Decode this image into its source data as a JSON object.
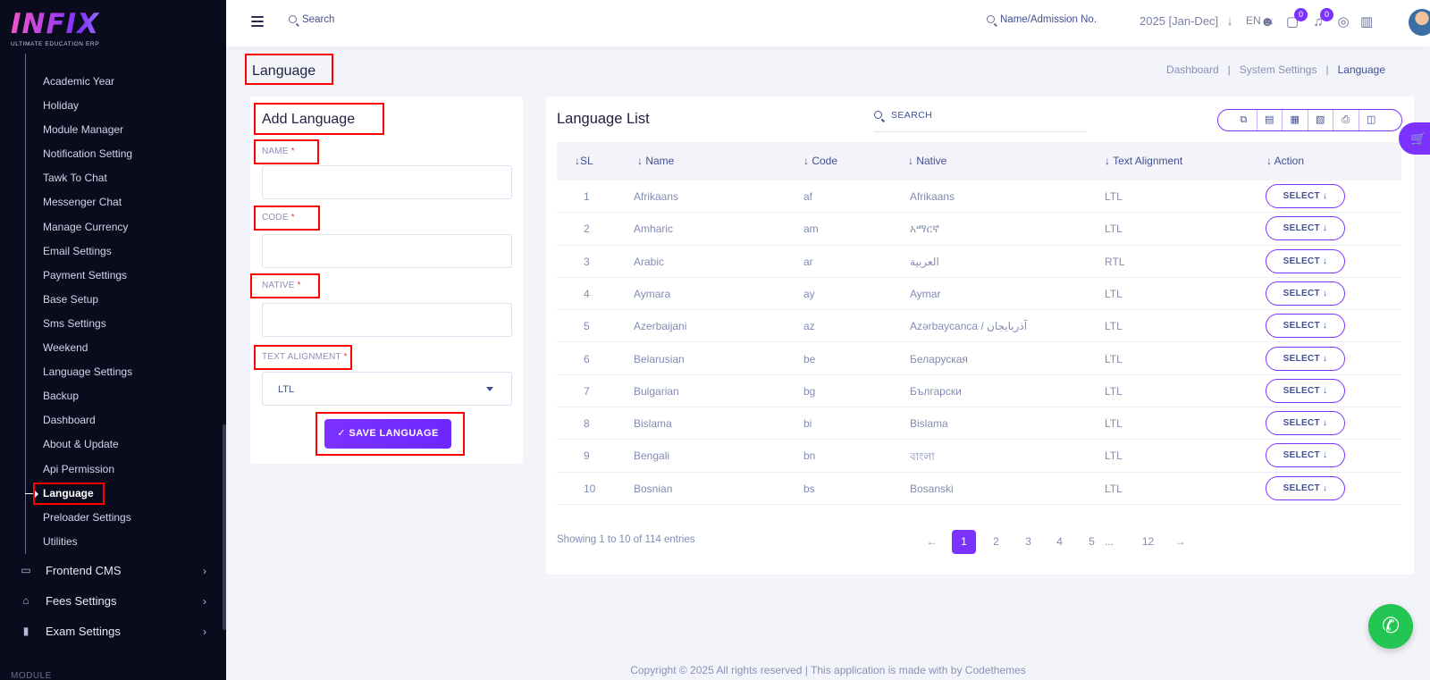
{
  "brand": {
    "logo_text": "INFIX",
    "tagline": "ULTIMATE EDUCATION ERP"
  },
  "sidebar": {
    "sub_items": [
      {
        "label": "Academic Year"
      },
      {
        "label": "Holiday"
      },
      {
        "label": "Module Manager"
      },
      {
        "label": "Notification Setting"
      },
      {
        "label": "Tawk To Chat"
      },
      {
        "label": "Messenger Chat"
      },
      {
        "label": "Manage Currency"
      },
      {
        "label": "Email Settings"
      },
      {
        "label": "Payment Settings"
      },
      {
        "label": "Base Setup"
      },
      {
        "label": "Sms Settings"
      },
      {
        "label": "Weekend"
      },
      {
        "label": "Language Settings"
      },
      {
        "label": "Backup"
      },
      {
        "label": "Dashboard"
      },
      {
        "label": "About & Update"
      },
      {
        "label": "Api Permission"
      },
      {
        "label": "Language",
        "active": true
      },
      {
        "label": "Preloader Settings"
      },
      {
        "label": "Utilities"
      }
    ],
    "main_items": [
      {
        "label": "Frontend CMS",
        "icon": "monitor-icon"
      },
      {
        "label": "Fees Settings",
        "icon": "bank-icon"
      },
      {
        "label": "Exam Settings",
        "icon": "book-icon"
      }
    ],
    "section_label": "MODULE"
  },
  "topbar": {
    "search_label": "Search",
    "name_search_label": "Name/Admission No.",
    "session": "2025 [Jan-Dec]",
    "language": "EN",
    "messages_count": "0",
    "notifications_count": "0"
  },
  "page": {
    "title": "Language",
    "breadcrumb": [
      "Dashboard",
      "System Settings",
      "Language"
    ]
  },
  "form": {
    "title": "Add Language",
    "name_label": "NAME",
    "code_label": "CODE",
    "native_label": "NATIVE",
    "alignment_label": "TEXT ALIGNMENT",
    "required_mark": "*",
    "alignment_value": "LTL",
    "save_label": "SAVE LANGUAGE"
  },
  "list": {
    "title": "Language List",
    "search_placeholder": "SEARCH",
    "columns": [
      "SL",
      "Name",
      "Code",
      "Native",
      "Text Alignment",
      "Action"
    ],
    "rows": [
      {
        "sl": "1",
        "name": "Afrikaans",
        "code": "af",
        "native": "Afrikaans",
        "align": "LTL",
        "action": "SELECT"
      },
      {
        "sl": "2",
        "name": "Amharic",
        "code": "am",
        "native": "አማርኛ",
        "align": "LTL",
        "action": "SELECT"
      },
      {
        "sl": "3",
        "name": "Arabic",
        "code": "ar",
        "native": "العربية",
        "align": "RTL",
        "action": "SELECT"
      },
      {
        "sl": "4",
        "name": "Aymara",
        "code": "ay",
        "native": "Aymar",
        "align": "LTL",
        "action": "SELECT"
      },
      {
        "sl": "5",
        "name": "Azerbaijani",
        "code": "az",
        "native": "Azərbaycanca / آذربایجان",
        "align": "LTL",
        "action": "SELECT"
      },
      {
        "sl": "6",
        "name": "Belarusian",
        "code": "be",
        "native": "Беларуская",
        "align": "LTL",
        "action": "SELECT"
      },
      {
        "sl": "7",
        "name": "Bulgarian",
        "code": "bg",
        "native": "Български",
        "align": "LTL",
        "action": "SELECT"
      },
      {
        "sl": "8",
        "name": "Bislama",
        "code": "bi",
        "native": "Bislama",
        "align": "LTL",
        "action": "SELECT"
      },
      {
        "sl": "9",
        "name": "Bengali",
        "code": "bn",
        "native": "বাংলা",
        "align": "LTL",
        "action": "SELECT"
      },
      {
        "sl": "10",
        "name": "Bosnian",
        "code": "bs",
        "native": "Bosanski",
        "align": "LTL",
        "action": "SELECT"
      }
    ],
    "showing_text": "Showing 1 to 10 of 114 entries",
    "pages": [
      "1",
      "2",
      "3",
      "4",
      "5",
      "...",
      "12"
    ],
    "current_page": "1"
  },
  "footer": {
    "text": "Copyright © 2025 All rights reserved | This application is made with by Codethemes"
  },
  "colors": {
    "accent": "#7c32ff",
    "sidebar_bg": "#0b0b1e",
    "highlight": "#ff0000",
    "whatsapp": "#23c552"
  }
}
